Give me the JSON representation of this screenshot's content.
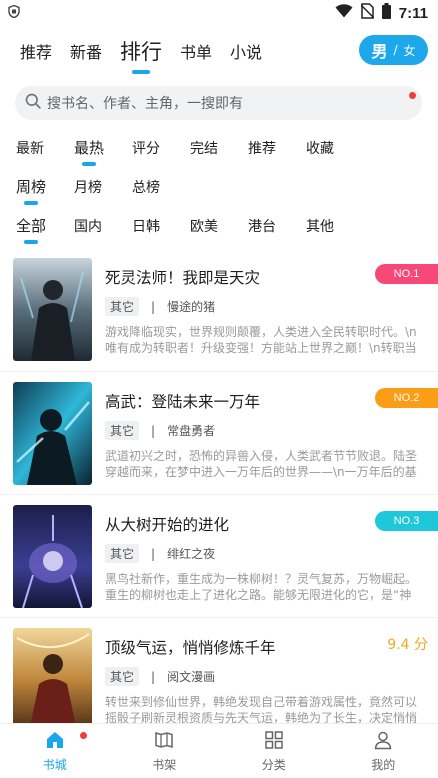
{
  "status_bar": {
    "time": "7:11"
  },
  "top_nav": {
    "tabs": [
      {
        "label": "推荐"
      },
      {
        "label": "新番"
      },
      {
        "label": "排行"
      },
      {
        "label": "书单"
      },
      {
        "label": "小说"
      }
    ],
    "active_tab": "排行",
    "gender": {
      "male": "男",
      "sep": "/",
      "female": "女"
    }
  },
  "search": {
    "placeholder": "搜书名、作者、主角，一搜即有"
  },
  "filters": {
    "sort": [
      "最新",
      "最热",
      "评分",
      "完结",
      "推荐",
      "收藏"
    ],
    "period": [
      "周榜",
      "月榜",
      "总榜"
    ],
    "region": [
      "全部",
      "国内",
      "日韩",
      "欧美",
      "港台",
      "其他"
    ],
    "active": {
      "sort": "最热",
      "period": "周榜",
      "region": "全部"
    }
  },
  "books": [
    {
      "title": "死灵法师！我即是天灾",
      "tag": "其它",
      "author": "慢途的猪",
      "desc": "游戏降临现实，世界规则颠覆，人类进入全民转职时代。\\n唯有成为转职者！升级变强！方能站上世界之巅！\\n转职当天…",
      "rank": "NO.1",
      "badge_color": "#f7487a"
    },
    {
      "title": "高武：登陆未来一万年",
      "tag": "其它",
      "author": "常盘勇者",
      "desc": "武道初兴之时，恐怖的异兽入侵，人类武者节节败退。陆圣穿越而来，在梦中进入一万年后的世界——\\n一万年后的基础练…",
      "rank": "NO.2",
      "badge_color": "#fb9d16"
    },
    {
      "title": "从大树开始的进化",
      "tag": "其它",
      "author": "绯红之夜",
      "desc": "黑鸟社新作，重生成为一株柳树！？灵气复苏，万物崛起。重生的柳树也走上了进化之路。能够无限进化的它，是“神力”还…",
      "rank": "NO.3",
      "badge_color": "#1ec8d8"
    },
    {
      "title": "顶级气运，悄悄修炼千年",
      "tag": "其它",
      "author": "阅文漫画",
      "desc": "转世来到修仙世界，韩绝发现自己带着游戏属性，竟然可以摇骰子刷新灵根资质与先天气运，韩绝为了长生，决定悄悄修炼…",
      "score": "9.4 分"
    }
  ],
  "bottom_nav": [
    {
      "label": "书城",
      "icon": "home-icon"
    },
    {
      "label": "书架",
      "icon": "bookshelf-icon"
    },
    {
      "label": "分类",
      "icon": "category-grid-icon"
    },
    {
      "label": "我的",
      "icon": "person-icon"
    }
  ]
}
